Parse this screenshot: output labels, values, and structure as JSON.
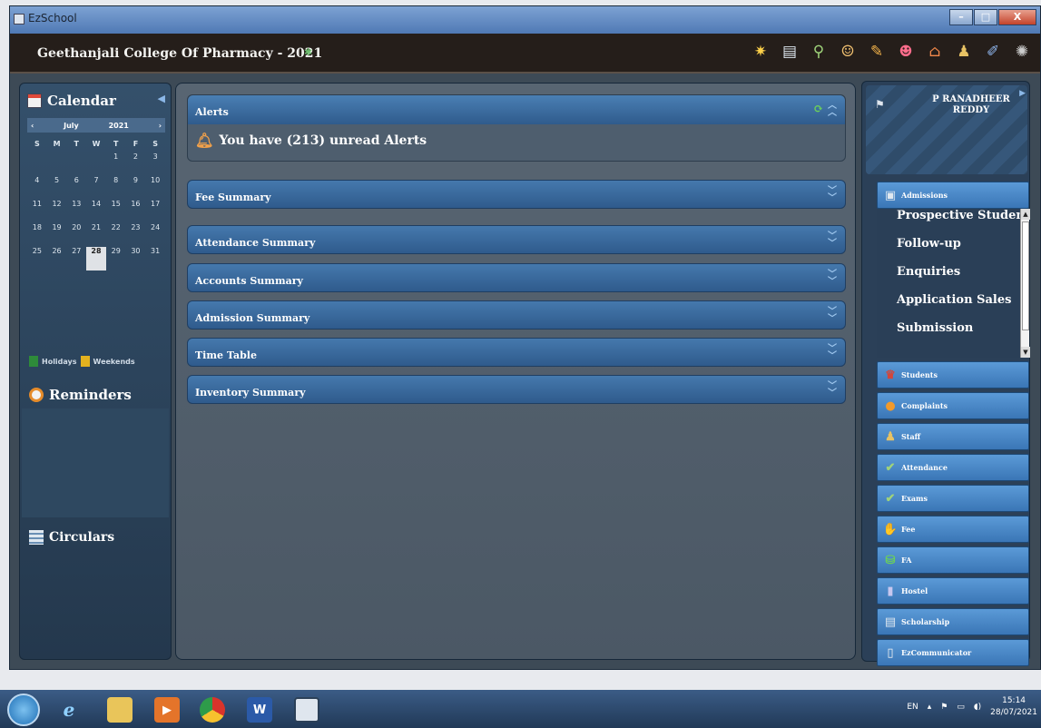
{
  "window": {
    "title": "EzSchool",
    "minimize": "–",
    "maximize": "□",
    "close": "X"
  },
  "header": {
    "college_title": "Geethanjali College Of Pharmacy - 2021",
    "toolbar_icons": [
      "gear-sparkle-icon",
      "newspaper-icon",
      "magnifier-icon",
      "people-icon",
      "palette-icon",
      "calculator-face-icon",
      "home-icon",
      "person-icon",
      "pencil-icon",
      "spinner-icon"
    ]
  },
  "calendar": {
    "heading": "Calendar",
    "month": "July",
    "year": "2021",
    "weekdays": [
      "S",
      "M",
      "T",
      "W",
      "T",
      "F",
      "S"
    ],
    "days": [
      "",
      "",
      "",
      "",
      "1",
      "2",
      "3",
      "4",
      "5",
      "6",
      "7",
      "8",
      "9",
      "10",
      "11",
      "12",
      "13",
      "14",
      "15",
      "16",
      "17",
      "18",
      "19",
      "20",
      "21",
      "22",
      "23",
      "24",
      "25",
      "26",
      "27",
      "28",
      "29",
      "30",
      "31"
    ],
    "today": "28",
    "legend_holidays": "Holidays",
    "legend_weekends": "Weekends",
    "holiday_color": "#2e8b3a",
    "weekend_color": "#e3b21f"
  },
  "reminders": {
    "heading": "Reminders"
  },
  "circulars": {
    "heading": "Circulars"
  },
  "main": {
    "alerts_title": "Alerts",
    "alerts_message": "You have (213) unread Alerts",
    "sections": [
      "Fee Summary",
      "Attendance Summary",
      "Accounts Summary",
      "Admission Summary",
      "Time Table",
      "Inventory Summary"
    ]
  },
  "user": {
    "name": "P RANADHEER REDDY"
  },
  "modules": {
    "admissions": "Admissions",
    "admissions_submenu": [
      "Prospective Students",
      "Follow-up",
      "Enquiries",
      "Application Sales",
      "Submission"
    ],
    "items": [
      "Students",
      "Complaints",
      "Staff",
      "Attendance",
      "Exams",
      "Fee",
      "FA",
      "Hostel",
      "Scholarship",
      "EzCommunicator"
    ]
  },
  "taskbar": {
    "language": "EN",
    "time": "15:14",
    "date": "28/07/2021"
  }
}
